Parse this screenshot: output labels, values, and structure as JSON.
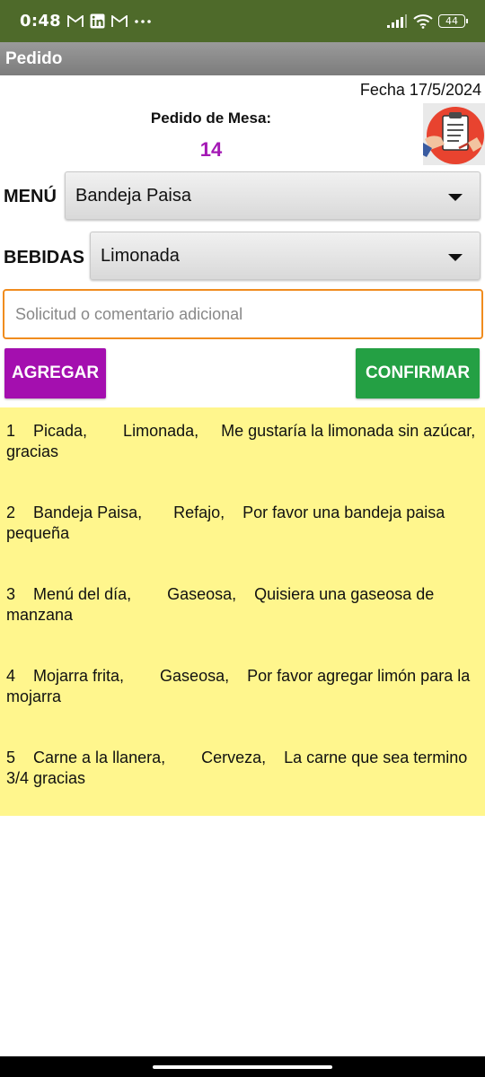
{
  "status_bar": {
    "time": "0:48",
    "left_icons": [
      "gmail-icon",
      "linkedin-icon",
      "gmail-icon",
      "more-dots-icon"
    ],
    "battery": "44"
  },
  "app": {
    "title": "Pedido"
  },
  "header": {
    "date": "Fecha 17/5/2024",
    "pedido_label": "Pedido de Mesa:",
    "table_number": "14",
    "logo_icon": "clipboard-order-icon"
  },
  "form": {
    "menu_label": "MENÚ",
    "menu_selected": "Bandeja Paisa",
    "bebidas_label": "BEBIDAS",
    "bebidas_selected": "Limonada",
    "comment_placeholder": "Solicitud o comentario adicional",
    "comment_value": ""
  },
  "buttons": {
    "agregar": "AGREGAR",
    "confirmar": "CONFIRMAR"
  },
  "orders": [
    {
      "text": "1    Picada,        Limonada,     Me gustaría la limonada sin azúcar, gracias"
    },
    {
      "text": "2    Bandeja Paisa,       Refajo,    Por favor una bandeja paisa pequeña"
    },
    {
      "text": "3    Menú del día,        Gaseosa,    Quisiera una gaseosa de manzana"
    },
    {
      "text": "4    Mojarra frita,        Gaseosa,    Por favor agregar limón para la mojarra"
    },
    {
      "text": "5    Carne a la llanera,        Cerveza,    La carne que sea termino 3/4 gracias"
    }
  ],
  "colors": {
    "status_bar": "#4e6a2a",
    "table_number": "#a419b5",
    "agregar_button": "#a40faf",
    "confirmar_button": "#24a044",
    "orders_background": "#fff68d",
    "comment_border": "#f08c1e"
  }
}
